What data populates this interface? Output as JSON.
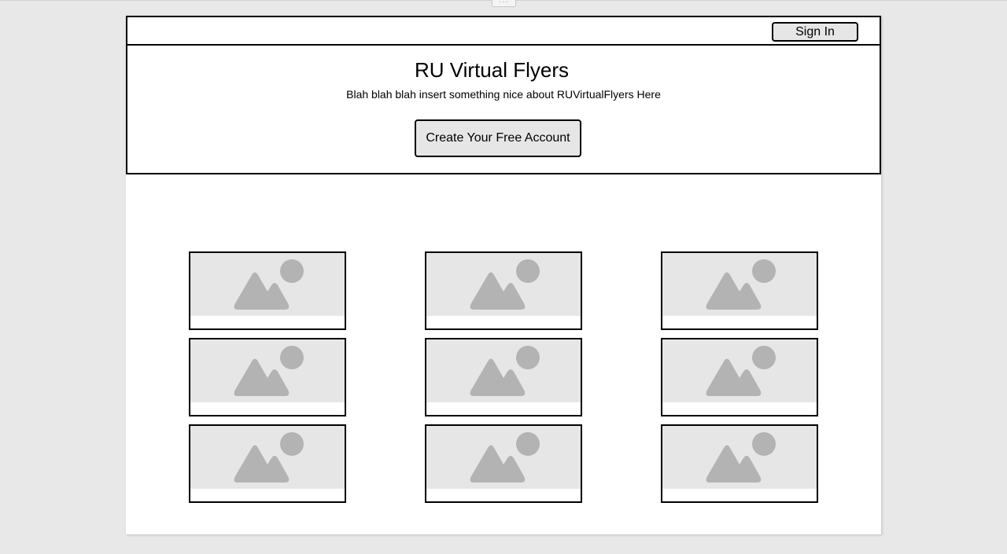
{
  "header": {
    "sign_in_label": "Sign In"
  },
  "hero": {
    "title": "RU Virtual Flyers",
    "subtitle": "Blah blah blah insert something nice about RUVirtualFlyers Here",
    "cta_label": "Create Your Free Account"
  },
  "window": {
    "handle_glyph": "···"
  },
  "flyer_grid": {
    "rows": 3,
    "columns": 3,
    "tile_icon": "image-placeholder-icon"
  },
  "colors": {
    "background": "#e8e8e8",
    "page": "#ffffff",
    "button_fill": "#e6e6e6",
    "placeholder_fill": "#e6e6e6",
    "placeholder_icon": "#b3b3b3",
    "border": "#000000"
  }
}
